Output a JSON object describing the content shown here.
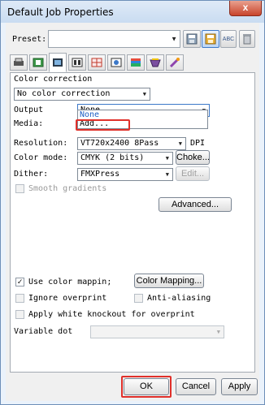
{
  "window": {
    "title": "Default Job Properties",
    "close_glyph": "x"
  },
  "preset": {
    "label": "Preset:",
    "value": "",
    "toolbar_icons": [
      "save-preset-icon",
      "save-as-preset-icon",
      "rename-preset-icon",
      "delete-preset-icon"
    ],
    "rename_badge": "ABC"
  },
  "tabs": {
    "icons": [
      "printer-tab-icon",
      "media-tab-icon",
      "color-tab-icon",
      "layout-tab-icon",
      "marks-tab-icon",
      "image-tab-icon",
      "spot-color-tab-icon",
      "finishing-tab-icon",
      "misc-tab-icon"
    ],
    "selected_index": 2
  },
  "color_page": {
    "section_label": "Color correction",
    "correction_value": "No color correction",
    "output_label": "Output",
    "output_value": "None",
    "media_label": "Media:",
    "dropdown_items": [
      "None",
      "Add..."
    ],
    "resolution_label": "Resolution:",
    "resolution_value": "VT720x2400 8Pass",
    "resolution_unit": "DPI",
    "color_mode_label": "Color mode:",
    "color_mode_value": "CMYK (2 bits)",
    "choke_label": "Choke...",
    "dither_label": "Dither:",
    "dither_value": "FMXPress",
    "edit_label": "Edit...",
    "smooth_gradients_label": "Smooth gradients",
    "advanced_label": "Advanced...",
    "use_color_mapping_label": "Use color mappin;",
    "use_color_mapping_checked": true,
    "color_mapping_button": "Color Mapping...",
    "ignore_overprint_label": "Ignore overprint",
    "anti_aliasing_label": "Anti-aliasing",
    "apply_white_knockout_label": "Apply white knockout for overprint",
    "variable_dot_label": "Variable dot",
    "variable_dot_value": ""
  },
  "footer": {
    "ok_label": "OK",
    "cancel_label": "Cancel",
    "apply_label": "Apply"
  },
  "colors": {
    "highlight": "#e0302a",
    "selected_text": "#1c5fc4",
    "accent": "#3c78c8"
  }
}
